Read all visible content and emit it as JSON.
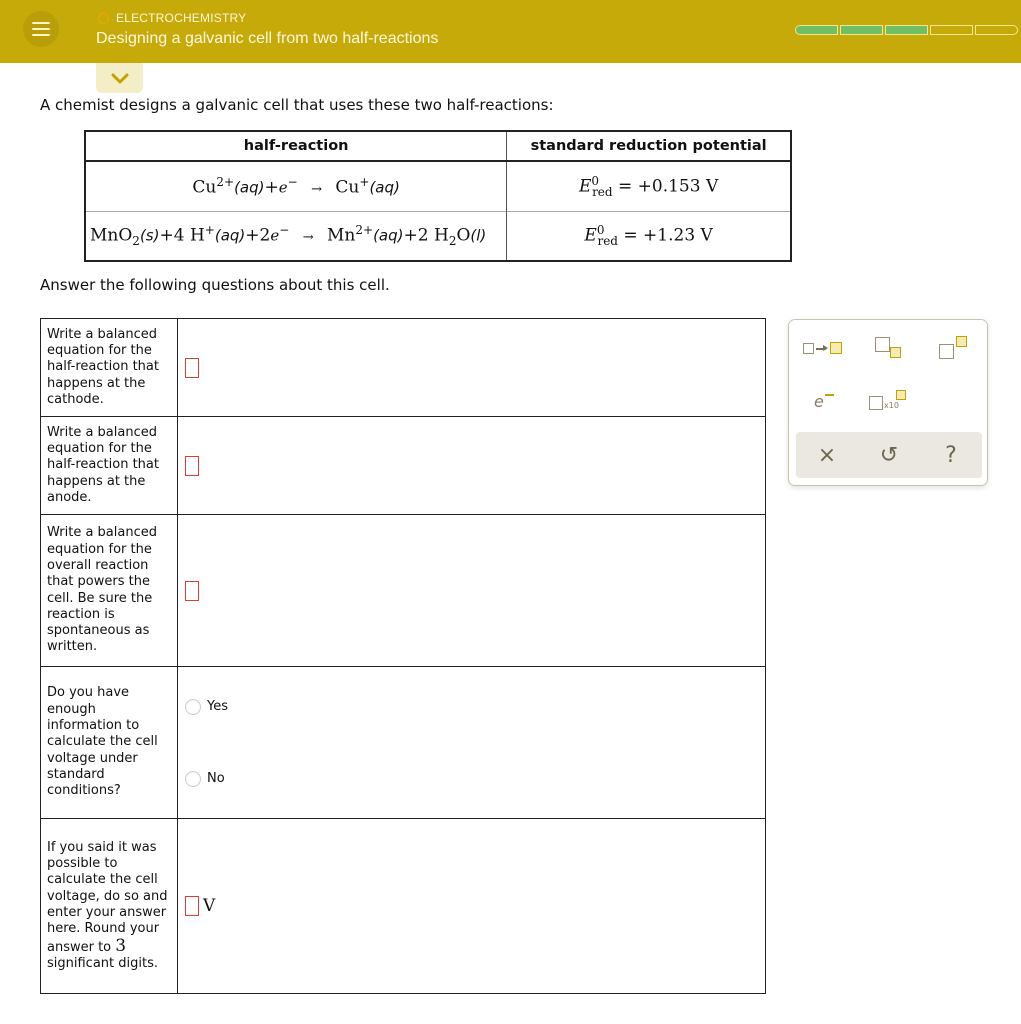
{
  "header": {
    "topic": "ELECTROCHEMISTRY",
    "title": "Designing a galvanic cell from two half-reactions",
    "menu_icon": "hamburger-menu-icon",
    "progress": {
      "filled": 3,
      "total": 5
    },
    "colors": {
      "header_bg": "#c6aa0a",
      "progress_filled": "#6fbf64",
      "topic_dot": "#f5a400"
    }
  },
  "collapse_icon": "chevron-down-icon",
  "intro": "A chemist designs a galvanic cell that uses these two half-reactions:",
  "half_reaction_table": {
    "headers": [
      "half-reaction",
      "standard reduction potential"
    ],
    "rows": [
      {
        "reaction": {
          "r1": "Cu",
          "r1_sup": "2+",
          "r1_state": "(aq)",
          "plus1": "+",
          "e": "e",
          "e_sup": "−",
          "arrow": "→",
          "p1": "Cu",
          "p1_sup": "+",
          "p1_state": "(aq)"
        },
        "potential": {
          "E": "E",
          "sup": "0",
          "sub": "red",
          "value": "= +0.153 V"
        }
      },
      {
        "reaction": {
          "r1": "MnO",
          "r1_sub": "2",
          "r1_state": "(s)",
          "plus1": "+",
          "coef2": "4",
          "r2": "H",
          "r2_sup": "+",
          "r2_state": "(aq)",
          "plus2": "+",
          "coef3": "2",
          "e": "e",
          "e_sup": "−",
          "arrow": "→",
          "p1": "Mn",
          "p1_sup": "2+",
          "p1_state": "(aq)",
          "plus3": "+",
          "coef4": "2",
          "p2a": "H",
          "p2_sub": "2",
          "p2b": "O",
          "p2_state": "(l)"
        },
        "potential": {
          "E": "E",
          "sup": "0",
          "sub": "red",
          "value": "= +1.23 V"
        }
      }
    ]
  },
  "outro": "Answer the following questions about this cell.",
  "questions": [
    {
      "text": "Write a balanced equation for the half-reaction that happens at the cathode.",
      "answer": ""
    },
    {
      "text": "Write a balanced equation for the half-reaction that happens at the anode.",
      "answer": ""
    },
    {
      "text": "Write a balanced equation for the overall reaction that powers the cell. Be sure the reaction is spontaneous as written.",
      "answer": ""
    },
    {
      "text": "Do you have enough information to calculate the cell voltage under standard conditions?",
      "options": [
        "Yes",
        "No"
      ],
      "selected": null
    },
    {
      "text_a": "If you said it was possible to calculate the cell voltage, do so and enter your answer here. Round your answer to",
      "sig": "3",
      "text_b": "significant digits.",
      "answer": "",
      "unit": "V"
    }
  ],
  "toolbox": {
    "tools": [
      {
        "name": "reaction-arrow-tool",
        "icon": "reaction-arrow-icon"
      },
      {
        "name": "subscript-tool",
        "icon": "subscript-icon"
      },
      {
        "name": "superscript-tool",
        "icon": "superscript-icon"
      },
      {
        "name": "electron-tool",
        "icon": "electron-icon",
        "label": "e"
      },
      {
        "name": "scientific-notation-tool",
        "icon": "scientific-notation-icon",
        "label": "x10"
      }
    ],
    "actions": [
      {
        "name": "clear-button",
        "icon": "close-icon",
        "glyph": "×"
      },
      {
        "name": "undo-button",
        "icon": "undo-icon",
        "glyph": "↺"
      },
      {
        "name": "help-button",
        "icon": "help-icon",
        "glyph": "?"
      }
    ]
  }
}
